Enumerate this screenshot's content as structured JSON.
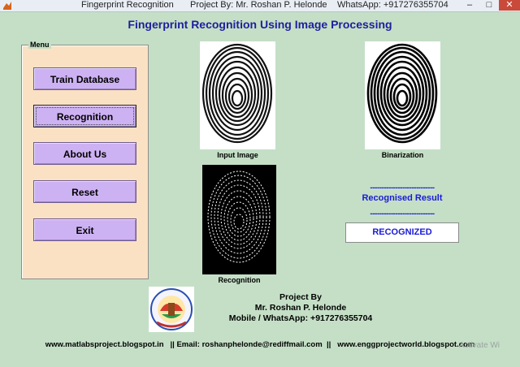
{
  "window": {
    "title": "Fingerprint Recognition",
    "title_author": "Project By: Mr. Roshan P. Helonde",
    "title_whatsapp": "WhatsApp: +917276355704",
    "controls": {
      "minimize": "–",
      "maximize": "□",
      "close": "✕"
    }
  },
  "header": {
    "title": "Fingerprint Recognition Using Image Processing"
  },
  "menu": {
    "legend": "Menu",
    "buttons": [
      "Train Database",
      "Recognition",
      "About Us",
      "Reset",
      "Exit"
    ]
  },
  "images": {
    "input_caption": "Input Image",
    "binarization_caption": "Binarization",
    "recognition_caption": "Recognition"
  },
  "result": {
    "dashes_top": "----------------------------",
    "label": "Recognised Result",
    "dashes_bottom": "----------------------------",
    "value": "RECOGNIZED"
  },
  "credits": {
    "line1": "Project By",
    "line2": "Mr. Roshan P. Helonde",
    "line3": "Mobile / WhatsApp: +917276355704"
  },
  "footer": {
    "text": "www.matlabsproject.blogspot.in   || Email: roshanphelonde@rediffmail.com  ||   www.enggprojectworld.blogspot.com"
  },
  "watermark": "Activate Wi",
  "colors": {
    "background": "#c4dfc6",
    "menu_panel": "#fbe1c3",
    "button": "#cdb2f3",
    "accent_text": "#1a1ad6"
  }
}
